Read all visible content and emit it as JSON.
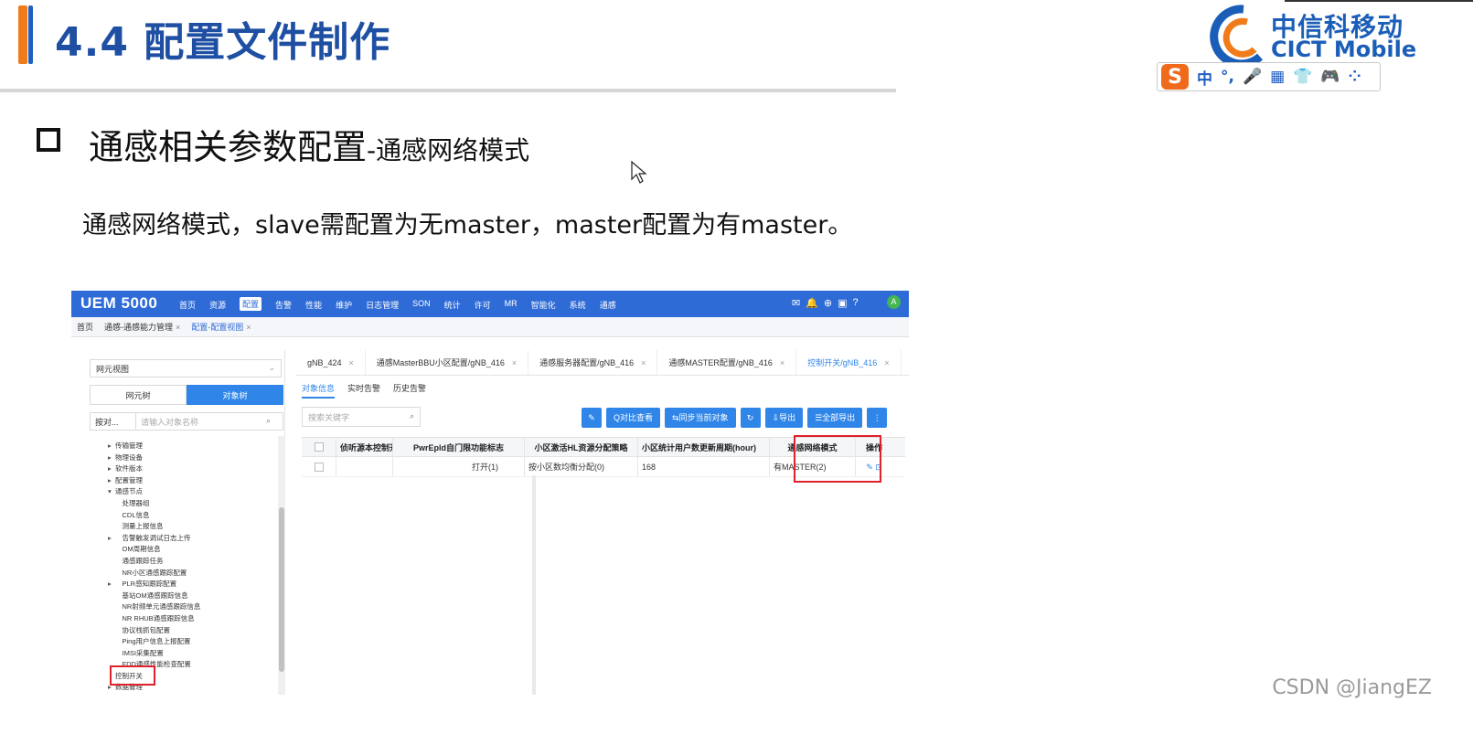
{
  "slide": {
    "title": "4.4 配置文件制作",
    "logo_cn": "中信科移动",
    "logo_en": "CICT Mobile",
    "ime": {
      "logo": "S",
      "icons": [
        "中",
        "°,",
        "🎤",
        "▦",
        "👕",
        "🎮",
        "⁘"
      ]
    },
    "heading_main": "通感相关参数配置",
    "heading_sub": "-通感网络模式",
    "description": "通感网络模式，slave需配置为无master，master配置为有master。",
    "watermark": "CSDN @JiangEZ"
  },
  "uem": {
    "brand": "UEM 5000",
    "menu": [
      "首页",
      "资源",
      "配置",
      "告警",
      "性能",
      "维护",
      "日志管理",
      "SON",
      "统计",
      "许可",
      "MR",
      "智能化",
      "系统",
      "通感"
    ],
    "active_menu": "配置",
    "header_icons": [
      "✉",
      "🔔",
      "⊕",
      "▣",
      "?"
    ],
    "avatar": "A",
    "breadcrumb": {
      "home": "首页",
      "tab1": "通感-通感能力管理",
      "tab2": "配置-配置视图"
    },
    "left": {
      "view_select": "网元视图",
      "tabs": [
        "网元树",
        "对象树"
      ],
      "search_kind": "按对...",
      "search_placeholder": "请输入对象名称",
      "tree": [
        {
          "t": "▸",
          "label": "传输管理"
        },
        {
          "t": "▸",
          "label": "物理设备"
        },
        {
          "t": "▸",
          "label": "软件版本"
        },
        {
          "t": "▸",
          "label": "配置管理"
        },
        {
          "t": "▾",
          "label": "通感节点"
        },
        {
          "t": "",
          "label": "　处理器组"
        },
        {
          "t": "",
          "label": "　CDL信息"
        },
        {
          "t": "",
          "label": "　测量上报信息"
        },
        {
          "t": "▸",
          "label": "　告警触发调试日志上传"
        },
        {
          "t": "",
          "label": "　OM周期信息"
        },
        {
          "t": "",
          "label": "　通感跟踪任务"
        },
        {
          "t": "",
          "label": "　NR小区通感跟踪配置"
        },
        {
          "t": "▸",
          "label": "　PLR感知跟踪配置"
        },
        {
          "t": "",
          "label": "　基站OM通感跟踪信息"
        },
        {
          "t": "",
          "label": "　NR射频单元通感跟踪信息"
        },
        {
          "t": "",
          "label": "　NR RHUB通感跟踪信息"
        },
        {
          "t": "",
          "label": "　协议栈抓包配置"
        },
        {
          "t": "",
          "label": "　Ping用户信息上报配置"
        },
        {
          "t": "",
          "label": "　IMSI采集配置"
        },
        {
          "t": "",
          "label": "　FDD通感性能检查配置"
        },
        {
          "t": "",
          "label": "控制开关"
        },
        {
          "t": "▸",
          "label": "数据管理"
        }
      ]
    },
    "right": {
      "tabs": [
        {
          "label": "gNB_424"
        },
        {
          "label": "通感MasterBBU小区配置/gNB_416"
        },
        {
          "label": "通感服务器配置/gNB_416"
        },
        {
          "label": "通感MASTER配置/gNB_416"
        },
        {
          "label": "控制开关/gNB_416"
        }
      ],
      "subtabs": [
        "对象信息",
        "实时告警",
        "历史告警"
      ],
      "search_placeholder": "搜索关键字",
      "buttons": {
        "edit": "✎",
        "compare": "Q对比查看",
        "sync": "⇆同步当前对象",
        "refresh": "↻",
        "export": "⇩导出",
        "export_all": "☰全部导出",
        "more": "⋮"
      },
      "columns": [
        "侦听源本控制开关",
        "PwrEpld自门限功能标志",
        "小区激活HL资源分配策略",
        "小区统计用户数更新周期(hour)",
        "通感网络模式",
        "操作"
      ],
      "rows": [
        {
          "c1": "",
          "c2": "打开(1)",
          "c3": "按小区数均衡分配(0)",
          "c4": "168",
          "c5": "有MASTER(2)",
          "c6": "✎ ⊡"
        }
      ]
    }
  }
}
